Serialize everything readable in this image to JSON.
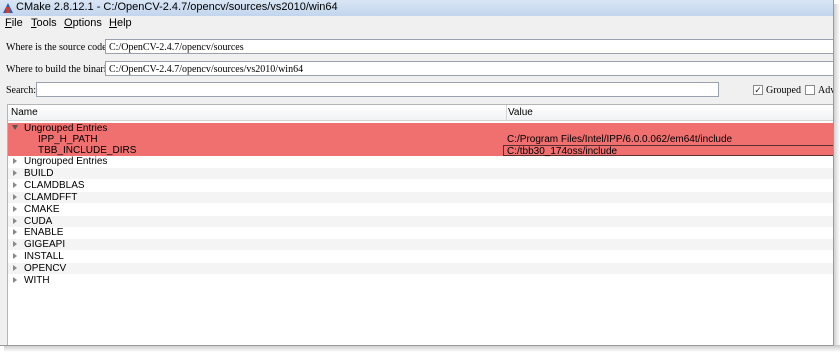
{
  "window": {
    "title": "CMake 2.8.12.1 - C:/OpenCV-2.4.7/opencv/sources/vs2010/win64"
  },
  "menu": [
    {
      "label": "File",
      "key": "F",
      "rest": "ile"
    },
    {
      "label": "Tools",
      "key": "T",
      "rest": "ools"
    },
    {
      "label": "Options",
      "key": "O",
      "rest": "ptions"
    },
    {
      "label": "Help",
      "key": "H",
      "rest": "elp"
    }
  ],
  "source": {
    "label": "Where is the source code:",
    "value": "C:/OpenCV-2.4.7/opencv/sources"
  },
  "build": {
    "label": "Where to build the binaries:",
    "value": "C:/OpenCV-2.4.7/opencv/sources/vs2010/win64"
  },
  "search": {
    "label": "Search:",
    "value": ""
  },
  "options": {
    "grouped_label": "Grouped",
    "grouped_checked": true,
    "advanced_label": "Adva",
    "advanced_checked": false
  },
  "table": {
    "headers": {
      "name": "Name",
      "value": "Value"
    },
    "highlight_color": "#f07070",
    "new_group": {
      "label": "Ungrouped Entries",
      "entries": [
        {
          "name": "IPP_H_PATH",
          "value": "C:/Program Files/Intel/IPP/6.0.0.062/em64t/include"
        },
        {
          "name": "TBB_INCLUDE_DIRS",
          "value": "C:/tbb30_174oss/include"
        }
      ]
    },
    "groups": [
      "Ungrouped Entries",
      "BUILD",
      "CLAMDBLAS",
      "CLAMDFFT",
      "CMAKE",
      "CUDA",
      "ENABLE",
      "GIGEAPI",
      "INSTALL",
      "OPENCV",
      "WITH"
    ]
  }
}
